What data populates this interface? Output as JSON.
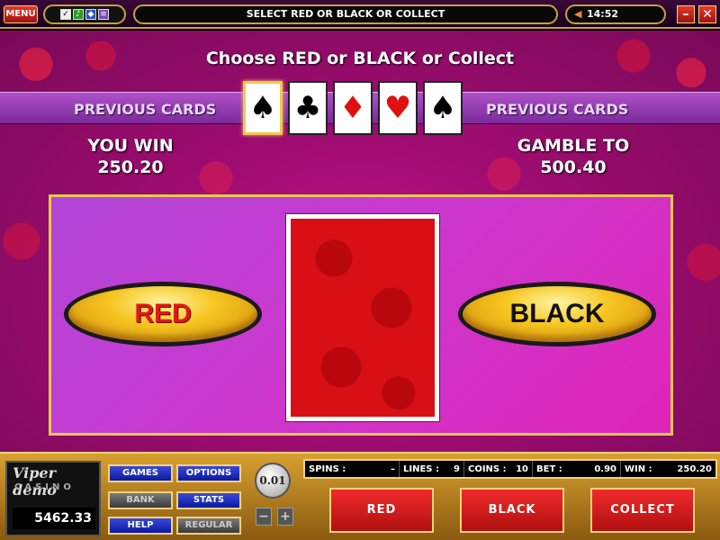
{
  "topbar": {
    "menu_label": "MENU",
    "message": "SELECT RED OR BLACK OR COLLECT",
    "time": "14:52"
  },
  "game": {
    "prompt": "Choose RED or BLACK or Collect",
    "previous_cards_label": "PREVIOUS CARDS",
    "previous_cards": [
      {
        "suit": "♠",
        "color": "black",
        "selected": true
      },
      {
        "suit": "♣",
        "color": "black",
        "selected": false
      },
      {
        "suit": "♦",
        "color": "red",
        "selected": false
      },
      {
        "suit": "♥",
        "color": "red",
        "selected": false
      },
      {
        "suit": "♠",
        "color": "black",
        "selected": false
      }
    ],
    "you_win_label": "YOU WIN",
    "you_win_value": "250.20",
    "gamble_to_label": "GAMBLE TO",
    "gamble_to_value": "500.40",
    "red_button": "RED",
    "black_button": "BLACK"
  },
  "console": {
    "logo_viper": "Viper demo",
    "logo_casino": "CASINO",
    "balance": "5462.33",
    "menu_buttons": {
      "games": "GAMES",
      "options": "OPTIONS",
      "bank": "BANK",
      "stats": "STATS",
      "help": "HELP",
      "regular": "REGULAR"
    },
    "coin_value": "0.01",
    "stepper_minus": "−",
    "stepper_plus": "+",
    "info": {
      "spins_label": "SPINS :",
      "spins_value": "–",
      "lines_label": "LINES :",
      "lines_value": "9",
      "coins_label": "COINS :",
      "coins_value": "10",
      "bet_label": "BET :",
      "bet_value": "0.90",
      "win_label": "WIN :",
      "win_value": "250.20"
    },
    "actions": {
      "red": "RED",
      "black": "BLACK",
      "collect": "COLLECT"
    }
  }
}
